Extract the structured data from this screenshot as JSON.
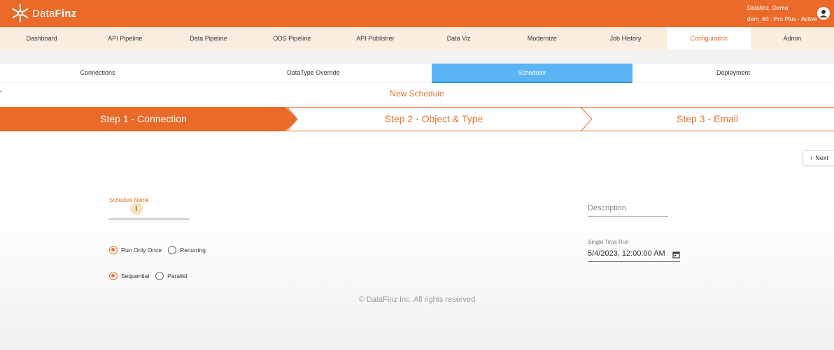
{
  "header": {
    "logo_text": "DataFinz",
    "user_name": "Datafinz, Demo",
    "user_plan": "dem_60 : Pro Plus - Active"
  },
  "main_nav": [
    {
      "label": "Dashboard"
    },
    {
      "label": "API Pipeline"
    },
    {
      "label": "Data Pipeline"
    },
    {
      "label": "ODS Pipeline"
    },
    {
      "label": "API Publisher"
    },
    {
      "label": "Data Viz"
    },
    {
      "label": "Modernize"
    },
    {
      "label": "Job History"
    },
    {
      "label": "Configuration",
      "active": true
    },
    {
      "label": "Admin"
    }
  ],
  "sub_tabs": [
    {
      "label": "Connections"
    },
    {
      "label": "DataType Override"
    },
    {
      "label": "Scheduler",
      "active": true
    },
    {
      "label": "Deployment"
    }
  ],
  "page_title": "New Schedule",
  "steps": [
    {
      "label": "Step 1 - Connection",
      "active": true
    },
    {
      "label": "Step 2 - Object & Type"
    },
    {
      "label": "Step 3 - Email"
    }
  ],
  "next_button": {
    "label": "Next"
  },
  "form": {
    "schedule_name_label": "Schedule Name",
    "schedule_name_value": "",
    "description_placeholder": "Description",
    "single_time_run_label": "Single Time Run",
    "single_time_run_value": "5/4/2023, 12:00:00 AM",
    "run_mode": [
      {
        "label": "Run Only Once",
        "selected": true
      },
      {
        "label": "Recurring",
        "selected": false
      }
    ],
    "execution": [
      {
        "label": "Sequential",
        "selected": true
      },
      {
        "label": "Parallel",
        "selected": false
      }
    ]
  },
  "footer": "© DataFinz Inc. All rights reserved",
  "colors": {
    "brand_orange": "#ea6a2a",
    "accent_orange": "#e8712d",
    "nav_bg": "#fbeee1",
    "active_tab_blue": "#5ab3f2"
  }
}
